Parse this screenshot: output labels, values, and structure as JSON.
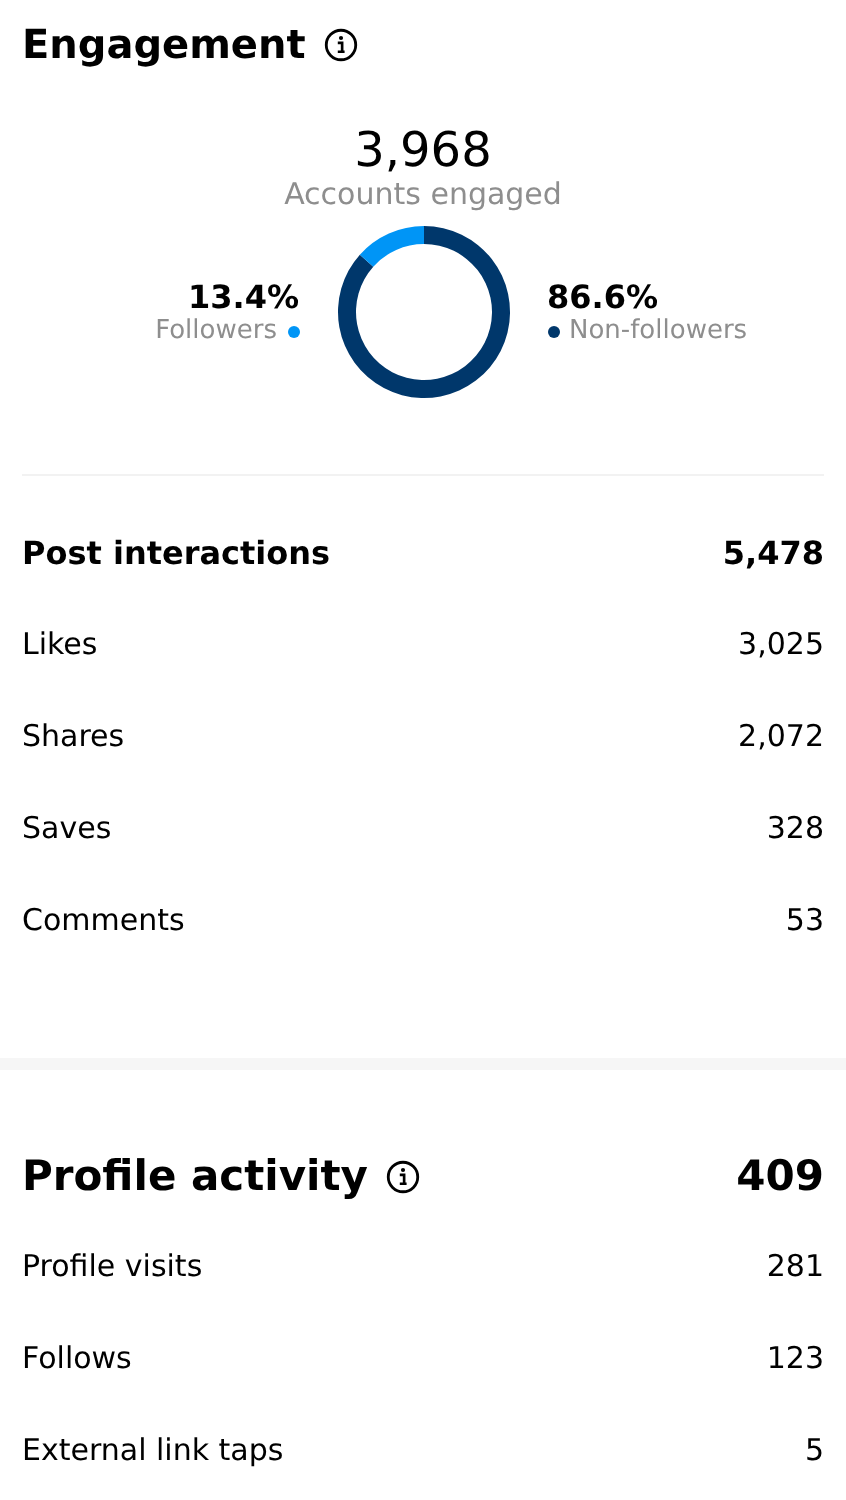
{
  "engagement": {
    "title": "Engagement",
    "total": "3,968",
    "total_label": "Accounts engaged",
    "legend": [
      {
        "percent": "13.4%",
        "color": "#0095f6"
      },
      {
        "percent": "86.6%",
        "color": "#00376b"
      }
    ],
    "chart_data": {
      "type": "donut",
      "categories": [
        "Followers",
        "Non-followers"
      ],
      "values": [
        13.4,
        86.6
      ]
    }
  },
  "post_interactions": {
    "title": "Post interactions",
    "value": "5,478",
    "rows": [
      {
        "label": "Likes",
        "value": "3,025"
      },
      {
        "label": "Shares",
        "value": "2,072"
      },
      {
        "label": "Saves",
        "value": "328"
      },
      {
        "label": "Comments",
        "value": "53"
      }
    ]
  },
  "profile_activity": {
    "title": "Profile activity",
    "value": "409",
    "rows": [
      {
        "label": "Profile visits",
        "value": "281"
      },
      {
        "label": "Follows",
        "value": "123"
      },
      {
        "label": "External link taps",
        "value": "5"
      }
    ]
  }
}
